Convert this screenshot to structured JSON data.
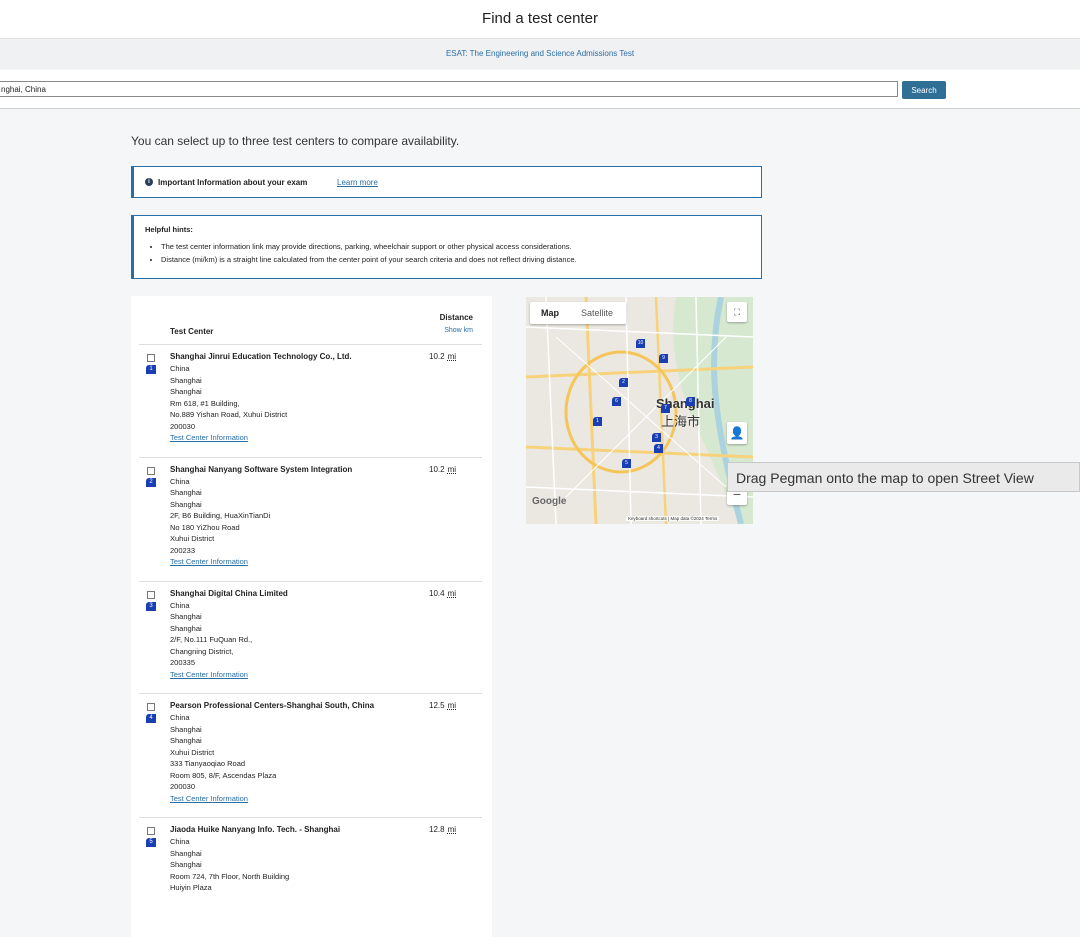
{
  "header": {
    "title": "Find a test center",
    "subtitle": "ESAT: The Engineering and Science Admissions Test"
  },
  "search": {
    "value": "nghai, China",
    "button_label": "Search"
  },
  "intro_text": "You can select up to three test centers to compare availability.",
  "info": {
    "text": "Important Information about your exam",
    "link": "Learn more",
    "icon": "i"
  },
  "hints": {
    "title": "Helpful hints:",
    "items": [
      "The test center information link may provide directions, parking, wheelchair support or other physical access considerations.",
      "Distance (mi/km) is a straight line calculated from the center point of your search criteria and does not reflect driving distance."
    ]
  },
  "table": {
    "col_center": "Test Center",
    "col_distance": "Distance",
    "show_km": "Show km"
  },
  "centers": [
    {
      "pin": "1",
      "name": "Shanghai Jinrui Education Technology Co., Ltd.",
      "distance": "10.2",
      "unit": "mi",
      "lines": [
        "China",
        "Shanghai",
        "Shanghai",
        "Rm 618, #1 Building,",
        "No.889 Yishan Road, Xuhui District",
        "200030"
      ],
      "link": "Test Center Information"
    },
    {
      "pin": "2",
      "name": "Shanghai Nanyang Software System Integration",
      "distance": "10.2",
      "unit": "mi",
      "lines": [
        "China",
        "Shanghai",
        "Shanghai",
        "2F, B6 Building, HuaXinTianDi",
        "No 180 YiZhou Road",
        "Xuhui District",
        "200233"
      ],
      "link": "Test Center Information"
    },
    {
      "pin": "3",
      "name": "Shanghai Digital China Limited",
      "distance": "10.4",
      "unit": "mi",
      "lines": [
        "China",
        "Shanghai",
        "Shanghai",
        "2/F, No.111 FuQuan Rd.,",
        "Changning District,",
        "200335"
      ],
      "link": "Test Center Information"
    },
    {
      "pin": "4",
      "name": "Pearson Professional Centers-Shanghai South, China",
      "distance": "12.5",
      "unit": "mi",
      "lines": [
        "China",
        "Shanghai",
        "Shanghai",
        "Xuhui District",
        "333 Tianyaoqiao Road",
        "Room 805, 8/F, Ascendas Plaza",
        "200030"
      ],
      "link": "Test Center Information"
    },
    {
      "pin": "5",
      "name": "Jiaoda Huike Nanyang Info. Tech. - Shanghai",
      "distance": "12.8",
      "unit": "mi",
      "lines": [
        "China",
        "Shanghai",
        "Shanghai",
        "Room 724, 7th Floor, North Building",
        "Huiyin Plaza"
      ],
      "link": ""
    }
  ],
  "map": {
    "tab_map": "Map",
    "tab_satellite": "Satellite",
    "city_en": "Shanghai",
    "city_zh": "上海市",
    "google": "Google",
    "attribution": "Keyboard shortcuts  |  Map data ©2024   Terms",
    "zoom_out": "−",
    "fullscreen_icon": "⛶",
    "pegman_icon": "👤",
    "pins": [
      "10",
      "9",
      "7",
      "6",
      "1",
      "3",
      "4",
      "5",
      "2",
      "8"
    ]
  },
  "tooltip": "Drag Pegman onto the map to open Street View"
}
